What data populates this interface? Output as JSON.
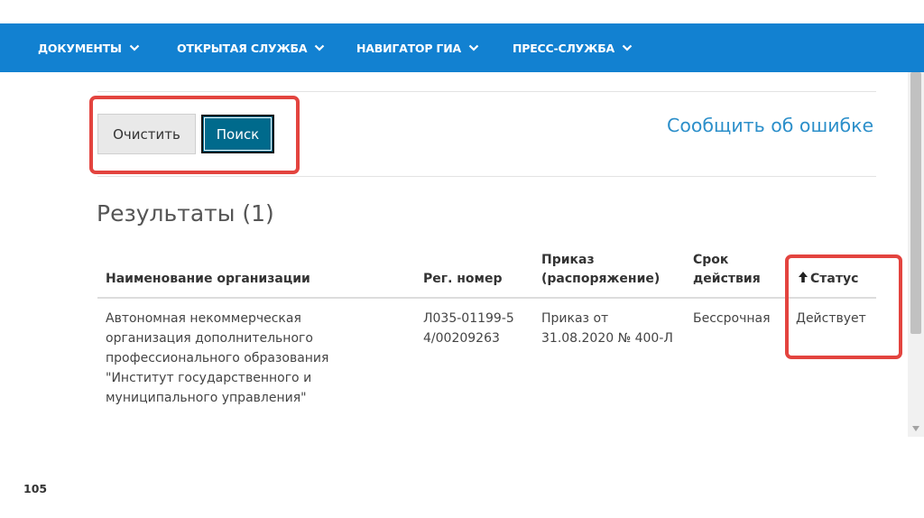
{
  "nav": {
    "items": [
      {
        "label": "ДОКУМЕНТЫ",
        "icon": "chevron-down-icon"
      },
      {
        "label": "ОТКРЫТАЯ СЛУЖБА",
        "icon": "chevron-down-icon"
      },
      {
        "label": "НАВИГАТОР ГИА",
        "icon": "chevron-down-icon"
      },
      {
        "label": "ПРЕСС-СЛУЖБА",
        "icon": "chevron-down-icon"
      }
    ]
  },
  "actions": {
    "clear_label": "Очистить",
    "search_label": "Поиск",
    "report_error_label": "Сообщить об ошибке"
  },
  "results": {
    "heading": "Результаты (1)",
    "columns": [
      "Наименование организации",
      "Рег. номер",
      "Приказ (распоряжение)",
      "Срок действия",
      "Статус"
    ],
    "sort_column": "Статус",
    "sort_icon": "arrow-up-icon",
    "rows": [
      {
        "organization": "Автономная некоммерческая организация дополнительного профессионального образования \"Институт государственного и муниципального управления\"",
        "reg_number": "Л035-01199-54/00209263",
        "order": "Приказ от 31.08.2020 № 400-Л",
        "validity": "Бессрочная",
        "status": "Действует"
      }
    ]
  },
  "footer": {
    "page_number": "105"
  },
  "colors": {
    "navbar": "#1281d1",
    "search_button": "#006a8c",
    "link": "#2c8fca",
    "highlight": "#e3443f"
  }
}
